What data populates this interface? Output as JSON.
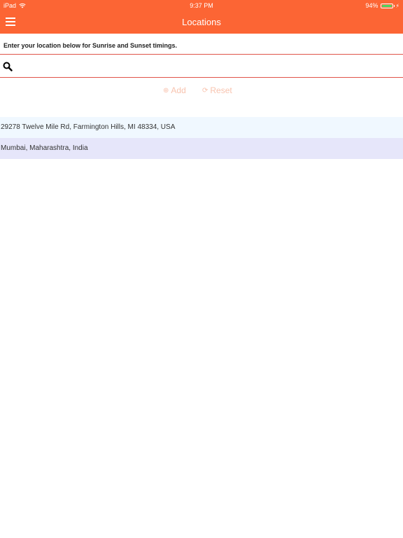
{
  "status_bar": {
    "carrier": "iPad",
    "time": "9:37 PM",
    "battery": "94%",
    "battery_level": 0.94,
    "battery_color": "#4cd964"
  },
  "nav": {
    "title": "Locations",
    "menu_icon": "hamburger-icon",
    "background": "#fc6534"
  },
  "instruction": "Enter your location below for Sunrise and Sunset timings.",
  "search": {
    "icon": "search-icon",
    "value": "",
    "placeholder": ""
  },
  "actions": {
    "add_label": "Add",
    "add_icon": "plus-circle-icon",
    "reset_label": "Reset",
    "reset_icon": "refresh-icon"
  },
  "locations": [
    "29278 Twelve Mile Rd, Farmington Hills, MI 48334, USA",
    "Mumbai, Maharashtra, India"
  ]
}
